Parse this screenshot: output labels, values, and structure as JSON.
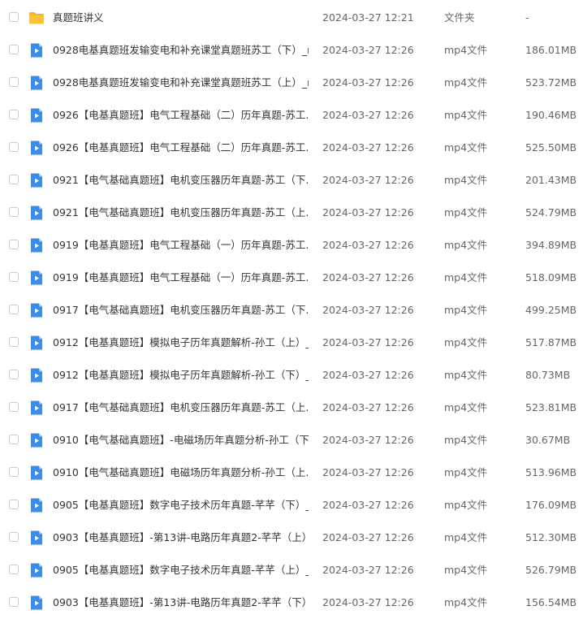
{
  "colors": {
    "folder": "#f9c43a",
    "folder_tab": "#f1b52a",
    "video": "#3b8de8",
    "checkbox_border": "#c8c8c8",
    "text": "#333333",
    "meta_text": "#666666"
  },
  "files": [
    {
      "icon": "folder-icon",
      "name": "真题班讲义",
      "date": "2024-03-27 12:21",
      "type": "文件夹",
      "size": "-"
    },
    {
      "icon": "video-file-icon",
      "name": "0928电基真题班发输变电和补充课堂真题班苏工（下）_r...",
      "date": "2024-03-27 12:26",
      "type": "mp4文件",
      "size": "186.01MB"
    },
    {
      "icon": "video-file-icon",
      "name": "0928电基真题班发输变电和补充课堂真题班苏工（上）_r...",
      "date": "2024-03-27 12:26",
      "type": "mp4文件",
      "size": "523.72MB"
    },
    {
      "icon": "video-file-icon",
      "name": "0926【电基真题班】电气工程基础（二）历年真题-苏工...",
      "date": "2024-03-27 12:26",
      "type": "mp4文件",
      "size": "190.46MB"
    },
    {
      "icon": "video-file-icon",
      "name": "0926【电基真题班】电气工程基础（二）历年真题-苏工...",
      "date": "2024-03-27 12:26",
      "type": "mp4文件",
      "size": "525.50MB"
    },
    {
      "icon": "video-file-icon",
      "name": "0921【电气基础真题班】电机变压器历年真题-苏工（下...",
      "date": "2024-03-27 12:26",
      "type": "mp4文件",
      "size": "201.43MB"
    },
    {
      "icon": "video-file-icon",
      "name": "0921【电气基础真题班】电机变压器历年真题-苏工（上...",
      "date": "2024-03-27 12:26",
      "type": "mp4文件",
      "size": "524.79MB"
    },
    {
      "icon": "video-file-icon",
      "name": "0919【电基真题班】电气工程基础（一）历年真题-苏工...",
      "date": "2024-03-27 12:26",
      "type": "mp4文件",
      "size": "394.89MB"
    },
    {
      "icon": "video-file-icon",
      "name": "0919【电基真题班】电气工程基础（一）历年真题-苏工...",
      "date": "2024-03-27 12:26",
      "type": "mp4文件",
      "size": "518.09MB"
    },
    {
      "icon": "video-file-icon",
      "name": "0917【电气基础真题班】电机变压器历年真题-苏工（下...",
      "date": "2024-03-27 12:26",
      "type": "mp4文件",
      "size": "499.25MB"
    },
    {
      "icon": "video-file-icon",
      "name": "0912【电基真题班】模拟电子历年真题解析-孙工（上）_...",
      "date": "2024-03-27 12:26",
      "type": "mp4文件",
      "size": "517.87MB"
    },
    {
      "icon": "video-file-icon",
      "name": "0912【电基真题班】模拟电子历年真题解析-孙工（下）_...",
      "date": "2024-03-27 12:26",
      "type": "mp4文件",
      "size": "80.73MB"
    },
    {
      "icon": "video-file-icon",
      "name": "0917【电气基础真题班】电机变压器历年真题-苏工（上...",
      "date": "2024-03-27 12:26",
      "type": "mp4文件",
      "size": "523.81MB"
    },
    {
      "icon": "video-file-icon",
      "name": "0910【电气基础真题班】-电磁场历年真题分析-孙工（下...",
      "date": "2024-03-27 12:26",
      "type": "mp4文件",
      "size": "30.67MB"
    },
    {
      "icon": "video-file-icon",
      "name": "0910【电气基础真题班】电磁场历年真题分析-孙工（上...",
      "date": "2024-03-27 12:26",
      "type": "mp4文件",
      "size": "513.96MB"
    },
    {
      "icon": "video-file-icon",
      "name": "0905【电基真题班】数字电子技术历年真题-芊芊（下）_...",
      "date": "2024-03-27 12:26",
      "type": "mp4文件",
      "size": "176.09MB"
    },
    {
      "icon": "video-file-icon",
      "name": "0903【电基真题班】-第13讲-电路历年真题2-芊芊（上）...",
      "date": "2024-03-27 12:26",
      "type": "mp4文件",
      "size": "512.30MB"
    },
    {
      "icon": "video-file-icon",
      "name": "0905【电基真题班】数字电子技术历年真题-芊芊（上）_...",
      "date": "2024-03-27 12:26",
      "type": "mp4文件",
      "size": "526.79MB"
    },
    {
      "icon": "video-file-icon",
      "name": "0903【电基真题班】-第13讲-电路历年真题2-芊芊（下）...",
      "date": "2024-03-27 12:26",
      "type": "mp4文件",
      "size": "156.54MB"
    }
  ]
}
